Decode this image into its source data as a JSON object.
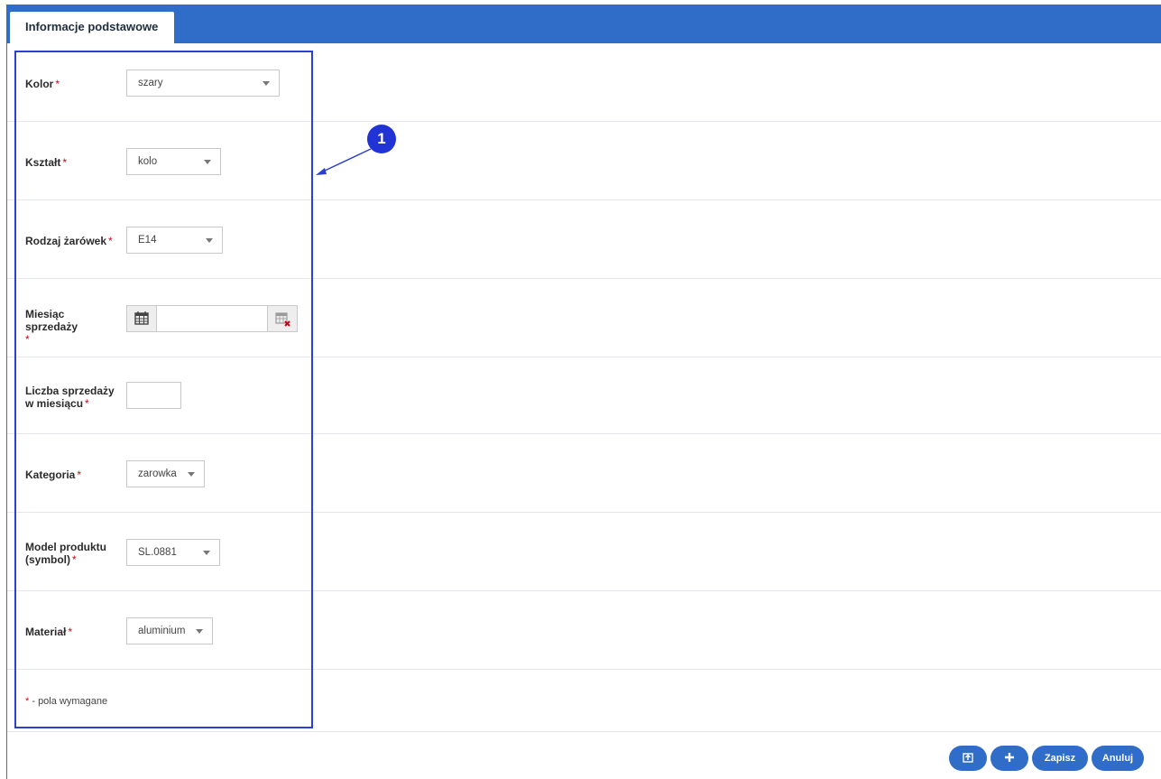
{
  "tabs": [
    {
      "label": "Informacje podstawowe"
    }
  ],
  "required_mark": "*",
  "form": {
    "kolor": {
      "label": "Kolor",
      "value": "szary"
    },
    "ksztalt": {
      "label": "Kształt",
      "value": "kolo"
    },
    "rodzaj": {
      "label": "Rodzaj żarówek",
      "value": "E14"
    },
    "miesiac": {
      "label": "Miesiąc sprzedaży",
      "value": ""
    },
    "liczba": {
      "label_line1": "Liczba sprzedaży",
      "label_line2": "w miesiącu",
      "value": ""
    },
    "kategoria": {
      "label": "Kategoria",
      "value": "zarowka"
    },
    "model": {
      "label_line1": "Model produktu",
      "label_line2": "(symbol)",
      "value": "SL.0881"
    },
    "material": {
      "label": "Materiał",
      "value": "aluminium"
    }
  },
  "footnote": "- pola wymagane",
  "annotation": {
    "marker": "1"
  },
  "buttons": {
    "save": "Zapisz",
    "cancel": "Anuluj",
    "back_icon": "back-icon",
    "add_icon": "plus-icon"
  },
  "colors": {
    "header": "#2f6dc8",
    "required": "#d0021b",
    "annotation": "#2b3fd1"
  }
}
